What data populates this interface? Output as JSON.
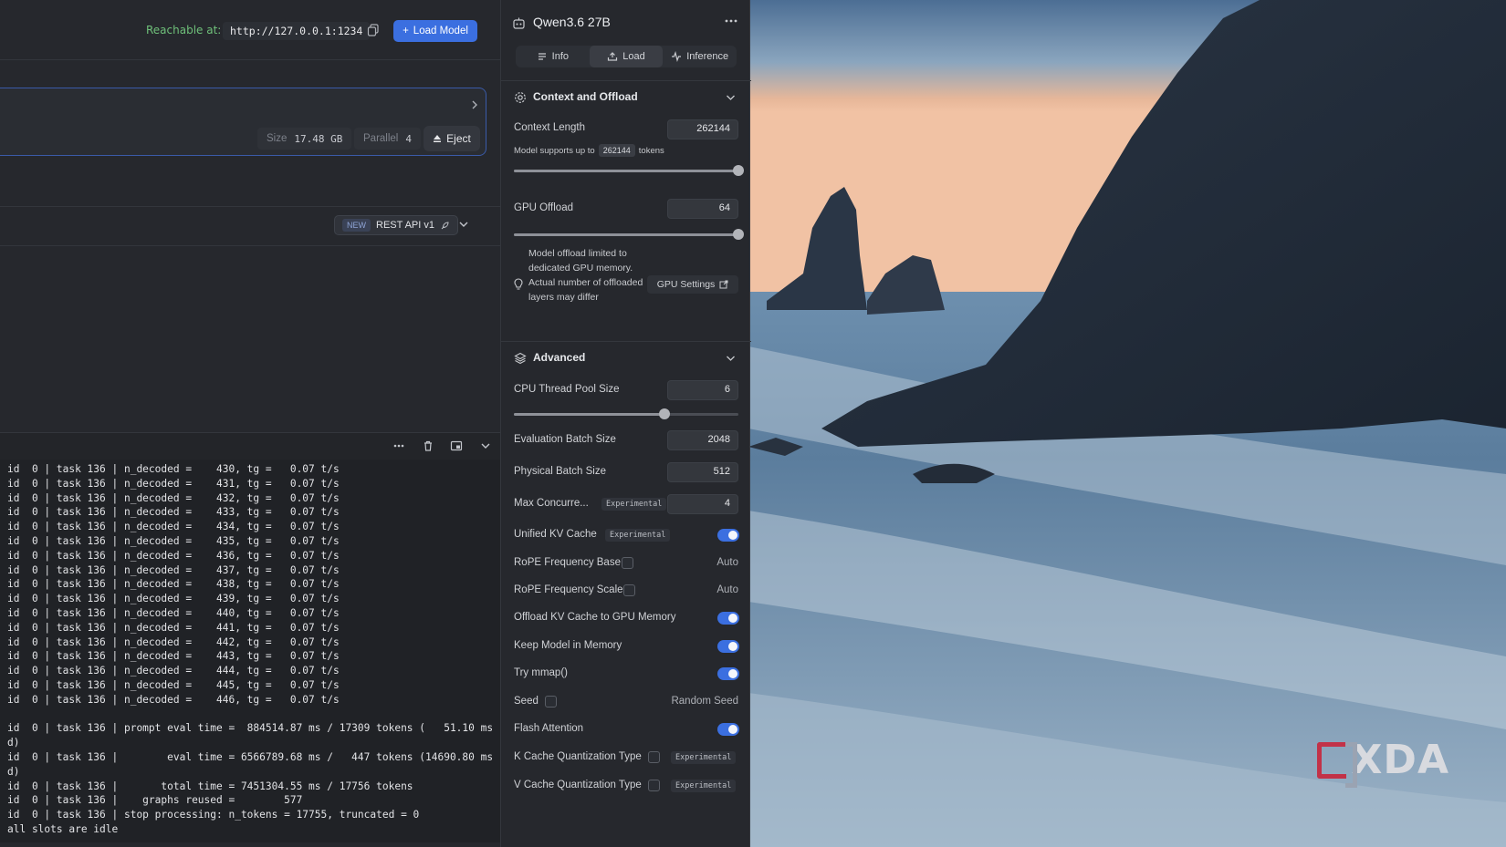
{
  "header": {
    "reachable_label": "Reachable at:",
    "url": "http://127.0.0.1:1234",
    "load_model_label": "Load Model"
  },
  "model_card": {
    "size_label": "Size",
    "size_value": "17.48 GB",
    "parallel_label": "Parallel",
    "parallel_value": "4",
    "eject_label": "Eject"
  },
  "api": {
    "new_badge": "NEW",
    "label": "REST API v1"
  },
  "log": {
    "lines": [
      "id  0 | task 136 | n_decoded =    430, tg =   0.07 t/s",
      "id  0 | task 136 | n_decoded =    431, tg =   0.07 t/s",
      "id  0 | task 136 | n_decoded =    432, tg =   0.07 t/s",
      "id  0 | task 136 | n_decoded =    433, tg =   0.07 t/s",
      "id  0 | task 136 | n_decoded =    434, tg =   0.07 t/s",
      "id  0 | task 136 | n_decoded =    435, tg =   0.07 t/s",
      "id  0 | task 136 | n_decoded =    436, tg =   0.07 t/s",
      "id  0 | task 136 | n_decoded =    437, tg =   0.07 t/s",
      "id  0 | task 136 | n_decoded =    438, tg =   0.07 t/s",
      "id  0 | task 136 | n_decoded =    439, tg =   0.07 t/s",
      "id  0 | task 136 | n_decoded =    440, tg =   0.07 t/s",
      "id  0 | task 136 | n_decoded =    441, tg =   0.07 t/s",
      "id  0 | task 136 | n_decoded =    442, tg =   0.07 t/s",
      "id  0 | task 136 | n_decoded =    443, tg =   0.07 t/s",
      "id  0 | task 136 | n_decoded =    444, tg =   0.07 t/s",
      "id  0 | task 136 | n_decoded =    445, tg =   0.07 t/s",
      "id  0 | task 136 | n_decoded =    446, tg =   0.07 t/s",
      "",
      "id  0 | task 136 | prompt eval time =  884514.87 ms / 17309 tokens (   51.10 ms",
      "d)",
      "id  0 | task 136 |        eval time = 6566789.68 ms /   447 tokens (14690.80 ms",
      "d)",
      "id  0 | task 136 |       total time = 7451304.55 ms / 17756 tokens",
      "id  0 | task 136 |    graphs reused =        577",
      "id  0 | task 136 | stop processing: n_tokens = 17755, truncated = 0",
      "all slots are idle"
    ]
  },
  "panel": {
    "title": "Qwen3.6 27B",
    "tabs": [
      {
        "label": "Info",
        "active": false
      },
      {
        "label": "Load",
        "active": true
      },
      {
        "label": "Inference",
        "active": false
      }
    ],
    "context": {
      "section_label": "Context and Offload",
      "context_length_label": "Context Length",
      "context_length_value": "262144",
      "supports_prefix": "Model supports up to",
      "supports_value": "262144",
      "supports_suffix": "tokens",
      "context_slider": 1.0,
      "gpu_offload_label": "GPU Offload",
      "gpu_offload_value": "64",
      "gpu_offload_slider": 1.0,
      "offload_note": "Model offload limited to dedicated GPU memory. Actual number of offloaded layers may differ",
      "gpu_settings_label": "GPU Settings"
    },
    "advanced": {
      "section_label": "Advanced",
      "cpu_thread_label": "CPU Thread Pool Size",
      "cpu_thread_value": "6",
      "cpu_thread_slider": 0.67,
      "eval_batch_label": "Evaluation Batch Size",
      "eval_batch_value": "2048",
      "physical_batch_label": "Physical Batch Size",
      "physical_batch_value": "512",
      "max_concurrent_label": "Max Concurre...",
      "max_concurrent_value": "4",
      "experimental_tag": "Experimental",
      "unified_kv_label": "Unified KV Cache",
      "unified_kv_enabled": true,
      "rope_base_label": "RoPE Frequency Base",
      "rope_base_value": "Auto",
      "rope_scale_label": "RoPE Frequency Scale",
      "rope_scale_value": "Auto",
      "offload_kv_label": "Offload KV Cache to GPU Memory",
      "offload_kv_enabled": true,
      "keep_memory_label": "Keep Model in Memory",
      "keep_memory_enabled": true,
      "mmap_label": "Try mmap()",
      "mmap_enabled": true,
      "seed_label": "Seed",
      "seed_value": "Random Seed",
      "flash_attention_label": "Flash Attention",
      "flash_attention_enabled": true,
      "k_cache_label": "K Cache Quantization Type",
      "v_cache_label": "V Cache Quantization Type"
    }
  },
  "watermark": "XDA",
  "colors": {
    "accent": "#3b6fe0",
    "reachable": "#6fc07a",
    "card_border": "#3a5aa8"
  }
}
